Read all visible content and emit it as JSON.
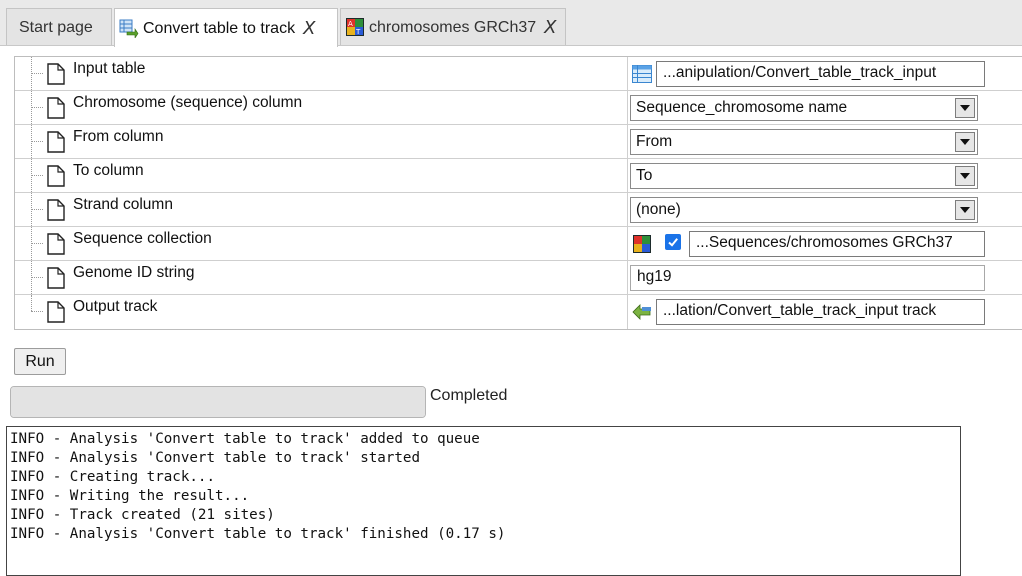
{
  "tabs": [
    {
      "label": "Start page",
      "icon": "",
      "closable": false,
      "active": false
    },
    {
      "label": "Convert table to track",
      "icon": "convert-table-icon",
      "closable": true,
      "active": true
    },
    {
      "label": "chromosomes GRCh37",
      "icon": "sequence-collection-icon",
      "closable": true,
      "active": false
    }
  ],
  "tab_close_glyph": "X",
  "params": {
    "input_table": {
      "label": "Input table",
      "value": "...anipulation/Convert_table_track_input",
      "icon": "table-icon"
    },
    "chromosome_column": {
      "label": "Chromosome (sequence) column",
      "value": "Sequence_chromosome name"
    },
    "from_column": {
      "label": "From column",
      "value": "From"
    },
    "to_column": {
      "label": "To column",
      "value": "To"
    },
    "strand_column": {
      "label": "Strand column",
      "value": "(none)"
    },
    "sequence_collection": {
      "label": "Sequence collection",
      "value": "...Sequences/chromosomes GRCh37",
      "checked": true,
      "icon": "sequence-collection-icon"
    },
    "genome_id": {
      "label": "Genome ID string",
      "value": "hg19"
    },
    "output_track": {
      "label": "Output track",
      "value": "...lation/Convert_table_track_input track",
      "icon": "track-icon"
    }
  },
  "run_label": "Run",
  "progress": {
    "percent": 100,
    "status": "Completed"
  },
  "log_lines": [
    "INFO - Analysis 'Convert table to track' added to queue",
    "INFO - Analysis 'Convert table to track' started",
    "INFO - Creating track...",
    "INFO - Writing the result...",
    "INFO - Track created (21 sites)",
    "INFO - Analysis 'Convert table to track' finished (0.17 s)"
  ]
}
